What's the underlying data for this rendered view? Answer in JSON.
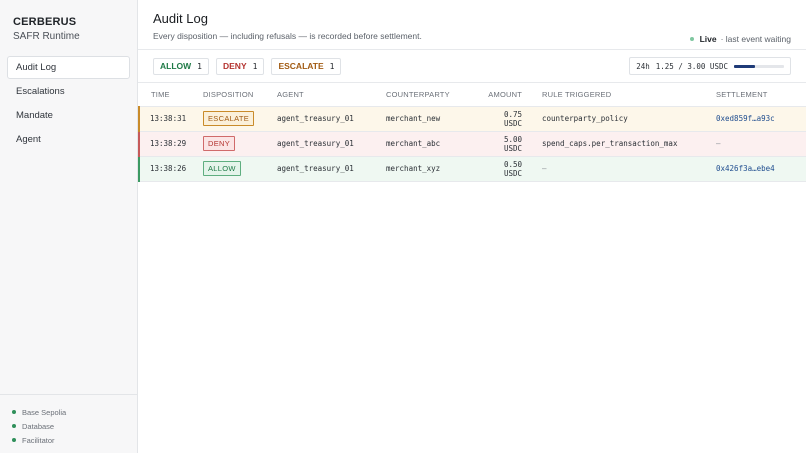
{
  "brand": {
    "name": "CERBERUS",
    "subtitle": "SAFR Runtime"
  },
  "nav": [
    {
      "label": "Audit Log",
      "active": true
    },
    {
      "label": "Escalations",
      "active": false
    },
    {
      "label": "Mandate",
      "active": false
    },
    {
      "label": "Agent",
      "active": false
    }
  ],
  "status": [
    {
      "label": "Base Sepolia",
      "color": "#2f8f5a"
    },
    {
      "label": "Database",
      "color": "#2f8f5a"
    },
    {
      "label": "Facilitator",
      "color": "#2f8f5a"
    }
  ],
  "header": {
    "title": "Audit Log",
    "subtitle": "Every disposition — including refusals — is recorded before settlement.",
    "live_label": "Live",
    "live_status": "· last event waiting"
  },
  "counts": [
    {
      "label": "ALLOW",
      "value": "1",
      "kind": "allow"
    },
    {
      "label": "DENY",
      "value": "1",
      "kind": "deny"
    },
    {
      "label": "ESCALATE",
      "value": "1",
      "kind": "escalate"
    }
  ],
  "budget": {
    "window": "24h",
    "text": "1.25 / 3.00 USDC",
    "fraction": 0.4167
  },
  "table": {
    "columns": [
      "TIME",
      "DISPOSITION",
      "AGENT",
      "COUNTERPARTY",
      "AMOUNT",
      "RULE TRIGGERED",
      "SETTLEMENT"
    ],
    "rows": [
      {
        "time": "13:38:31",
        "disposition": "ESCALATE",
        "kind": "escalate",
        "agent": "agent_treasury_01",
        "counterparty": "merchant_new",
        "amount": "0.75 USDC",
        "rule": "counterparty_policy",
        "settlement": "0xed859f…a93c"
      },
      {
        "time": "13:38:29",
        "disposition": "DENY",
        "kind": "deny",
        "agent": "agent_treasury_01",
        "counterparty": "merchant_abc",
        "amount": "5.00 USDC",
        "rule": "spend_caps.per_transaction_max",
        "settlement": "—"
      },
      {
        "time": "13:38:26",
        "disposition": "ALLOW",
        "kind": "allow",
        "agent": "agent_treasury_01",
        "counterparty": "merchant_xyz",
        "amount": "0.50 USDC",
        "rule": "—",
        "settlement": "0x426f3a…ebe4"
      }
    ]
  }
}
